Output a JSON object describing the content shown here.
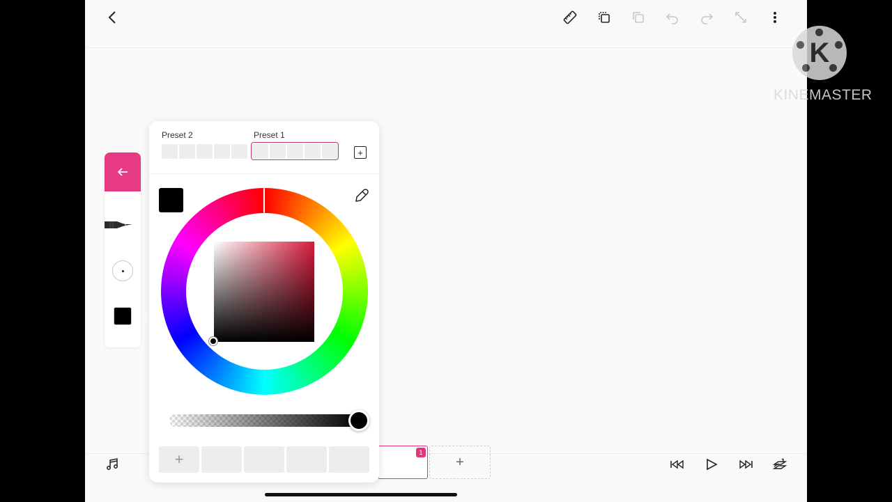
{
  "toolbar": {
    "icons": [
      "back-icon",
      "ruler-icon",
      "copy-layer-icon",
      "paste-icon",
      "undo-icon",
      "redo-icon",
      "expand-icon",
      "more-icon"
    ]
  },
  "color_panel": {
    "preset2_label": "Preset 2",
    "preset1_label": "Preset 1",
    "add_preset_label": "+",
    "current_color": "#000000",
    "hue_color": "#d81b3c",
    "alpha_percent": 100,
    "swatch_add_label": "+"
  },
  "bottom": {
    "frame_badge": "1",
    "add_frame_label": "+"
  },
  "watermark": {
    "text": "KINEMASTER",
    "logo_letter": "K"
  },
  "colors": {
    "accent": "#e83a84",
    "panel_bg": "#ffffff",
    "app_bg": "#f7f7f8"
  }
}
